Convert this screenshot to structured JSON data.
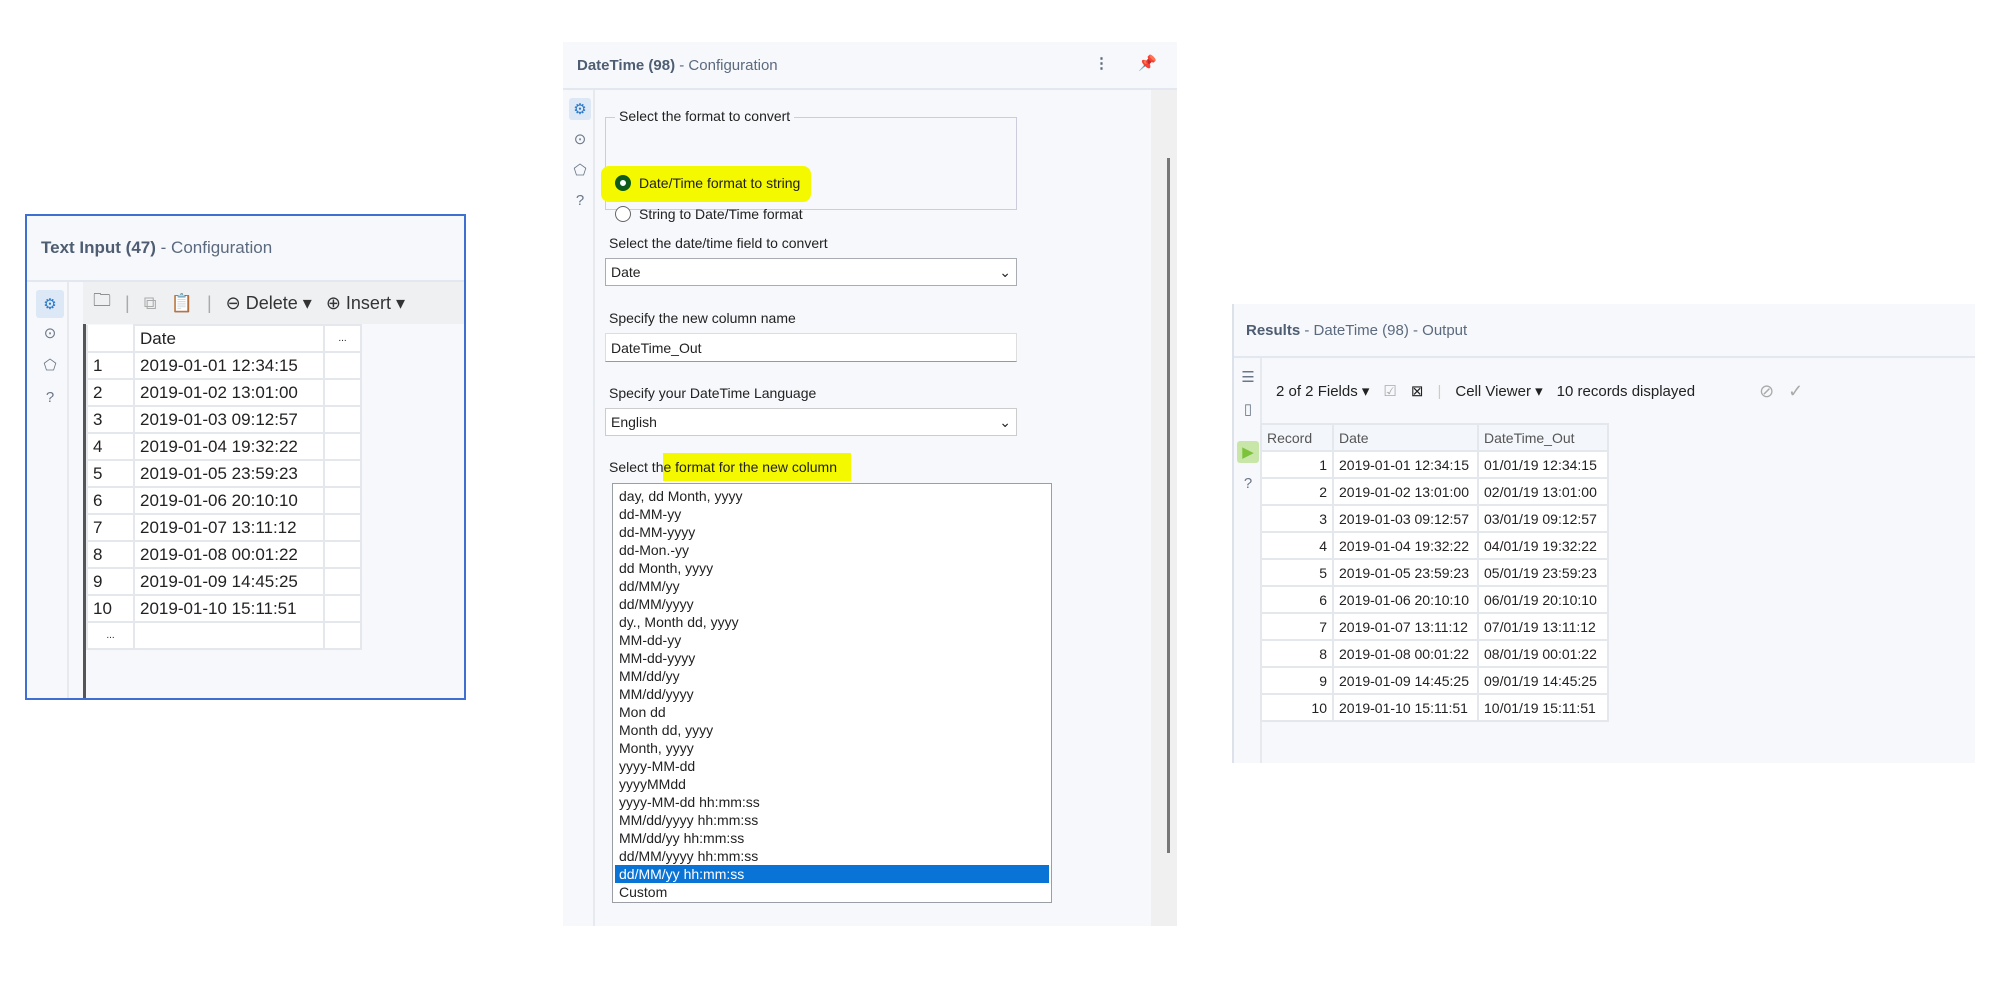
{
  "text_input": {
    "title": "Text Input (47)",
    "subtitle": "- Configuration",
    "toolbar": {
      "delete_label": "Delete",
      "insert_label": "Insert"
    },
    "column_header": "Date",
    "extra_header": "...",
    "new_row": "...",
    "rows": [
      [
        "1",
        "2019-01-01 12:34:15"
      ],
      [
        "2",
        "2019-01-02 13:01:00"
      ],
      [
        "3",
        "2019-01-03 09:12:57"
      ],
      [
        "4",
        "2019-01-04 19:32:22"
      ],
      [
        "5",
        "2019-01-05 23:59:23"
      ],
      [
        "6",
        "2019-01-06 20:10:10"
      ],
      [
        "7",
        "2019-01-07 13:11:12"
      ],
      [
        "8",
        "2019-01-08 00:01:22"
      ],
      [
        "9",
        "2019-01-09 14:45:25"
      ],
      [
        "10",
        "2019-01-10 15:11:51"
      ]
    ]
  },
  "datetime": {
    "title": "DateTime (98)",
    "subtitle": "- Configuration",
    "group_label": "Select the format to convert",
    "radio1": "Date/Time format to string",
    "radio2": "String to Date/Time format",
    "field_label": "Select the date/time field to convert",
    "field_value": "Date",
    "colname_label": "Specify the new column name",
    "colname_value": "DateTime_Out",
    "lang_label": "Specify your DateTime Language",
    "lang_value": "English",
    "format_label_a": "Select th",
    "format_label_b": "e format for the new column",
    "formats": [
      "day, dd Month, yyyy",
      "dd-MM-yy",
      "dd-MM-yyyy",
      "dd-Mon.-yy",
      "dd Month, yyyy",
      "dd/MM/yy",
      "dd/MM/yyyy",
      "dy., Month dd, yyyy",
      "MM-dd-yy",
      "MM-dd-yyyy",
      "MM/dd/yy",
      "MM/dd/yyyy",
      "Mon dd",
      "Month dd, yyyy",
      "Month, yyyy",
      "yyyy-MM-dd",
      "yyyyMMdd",
      "yyyy-MM-dd hh:mm:ss",
      "MM/dd/yyyy hh:mm:ss",
      "MM/dd/yy hh:mm:ss",
      "dd/MM/yyyy hh:mm:ss",
      "dd/MM/yy hh:mm:ss",
      "Custom"
    ],
    "selected_format": "dd/MM/yy hh:mm:ss"
  },
  "results": {
    "title": "Results",
    "subtitle": "- DateTime (98) - Output",
    "fields": "2 of 2 Fields",
    "viewer": "Cell Viewer",
    "count": "10 records displayed",
    "headers": [
      "Record",
      "Date",
      "DateTime_Out"
    ],
    "rows": [
      [
        "1",
        "2019-01-01 12:34:15",
        "01/01/19 12:34:15"
      ],
      [
        "2",
        "2019-01-02 13:01:00",
        "02/01/19 13:01:00"
      ],
      [
        "3",
        "2019-01-03 09:12:57",
        "03/01/19 09:12:57"
      ],
      [
        "4",
        "2019-01-04 19:32:22",
        "04/01/19 19:32:22"
      ],
      [
        "5",
        "2019-01-05 23:59:23",
        "05/01/19 23:59:23"
      ],
      [
        "6",
        "2019-01-06 20:10:10",
        "06/01/19 20:10:10"
      ],
      [
        "7",
        "2019-01-07 13:11:12",
        "07/01/19 13:11:12"
      ],
      [
        "8",
        "2019-01-08 00:01:22",
        "08/01/19 00:01:22"
      ],
      [
        "9",
        "2019-01-09 14:45:25",
        "09/01/19 14:45:25"
      ],
      [
        "10",
        "2019-01-10 15:11:51",
        "10/01/19 15:11:51"
      ]
    ]
  }
}
